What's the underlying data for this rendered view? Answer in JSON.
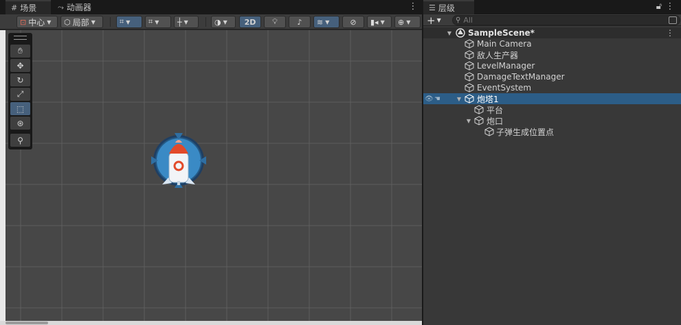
{
  "scene_panel": {
    "tabs": [
      {
        "label": "场景",
        "icon": "grid-icon"
      },
      {
        "label": "动画器",
        "icon": "animator-icon"
      }
    ],
    "toolbar": {
      "pivot_label": "中心",
      "space_label": "局部",
      "mode_2d_label": "2D"
    },
    "tool_palette": [
      "hand-tool",
      "move-tool",
      "rotate-tool",
      "scale-tool",
      "rect-tool",
      "transform-tool",
      "custom-tool"
    ],
    "selected_tool": "rect-tool",
    "sprite": {
      "name": "rocket-turret-sprite"
    }
  },
  "hierarchy_panel": {
    "tab_label": "层级",
    "search": {
      "placeholder": "All",
      "value": ""
    },
    "scene": {
      "name": "SampleScene*"
    },
    "items": [
      {
        "label": "Main Camera"
      },
      {
        "label": "敌人生产器"
      },
      {
        "label": "LevelManager"
      },
      {
        "label": "DamageTextManager"
      },
      {
        "label": "EventSystem"
      },
      {
        "label": "炮塔1"
      }
    ],
    "turret_children": [
      {
        "label": "平台"
      },
      {
        "label": "炮口"
      }
    ],
    "muzzle_children": [
      {
        "label": "子弹生成位置点"
      }
    ]
  },
  "colors": {
    "selection_blue": "#2c5d87",
    "active_toggle_blue": "#46607c",
    "scene_background": "#474747"
  }
}
